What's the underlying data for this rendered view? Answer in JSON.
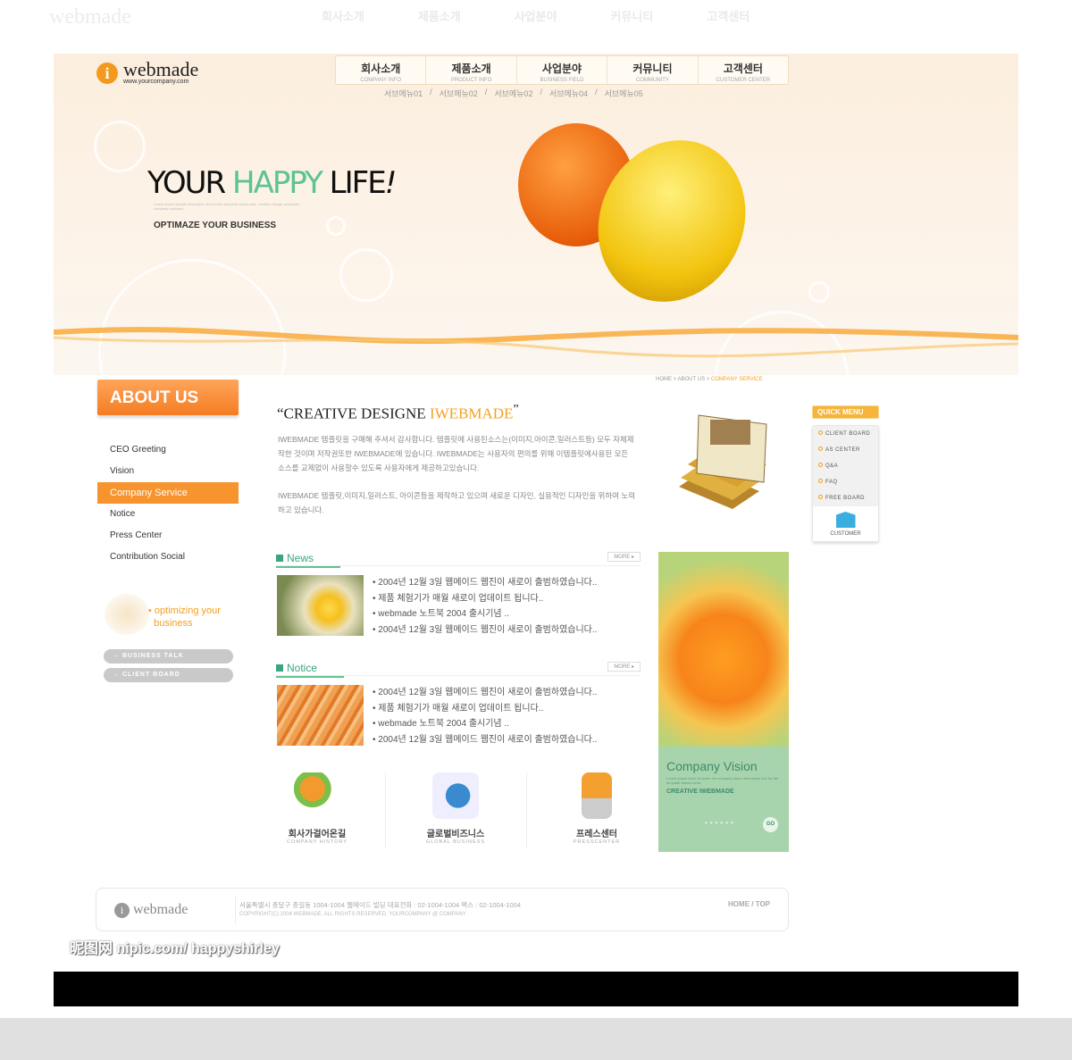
{
  "brand": {
    "name": "webmade",
    "url": "www.yourcompany.com",
    "icon": "i",
    "accent": "#f7942e",
    "green": "#5cc394"
  },
  "gnb": [
    {
      "ko": "회사소개",
      "en": "COMPANY INFO"
    },
    {
      "ko": "제품소개",
      "en": "PRODUCT INFO"
    },
    {
      "ko": "사업분야",
      "en": "BUSINESS FIELD"
    },
    {
      "ko": "커뮤니티",
      "en": "COMMUNITY"
    },
    {
      "ko": "고객센터",
      "en": "CUSTOMER CENTER"
    }
  ],
  "submenu": [
    "서브메뉴01",
    "/",
    "서브메뉴02",
    "/",
    "서브메뉴02",
    "/",
    "서브메뉴04",
    "/",
    "서브메뉴05"
  ],
  "hero": {
    "head1": "YOUR ",
    "head2": "HAPPY",
    "head3": " LIFE",
    "head4": "!",
    "tiny": "Lorem ipsum sample description text for the template visual area. Creative design webmade company business.",
    "sub": "OPTIMAZE YOUR BUSINESS"
  },
  "sidebar": {
    "title": "ABOUT US",
    "items": [
      "CEO Greeting",
      "Vision",
      "Company Service",
      "Notice",
      "Press Center",
      "Contribution Social"
    ],
    "promo1": "optimizing your",
    "promo2": "business",
    "buttons": [
      "→ BUSINESS TALK",
      "→ CLIENT BOARD"
    ],
    "bullet": "•"
  },
  "breadcrumb": {
    "a": "HOME > ABOUT US > ",
    "b": "COMPANY SERVICE"
  },
  "content": {
    "q1": "“",
    "title": "CREATIVE DESIGNE ",
    "title_hl": "IWEBMADE",
    "q2": "”",
    "p1": "IWEBMADE 템플릿을 구매해 주셔서 감사합니다. 템플릿에 사용된소스는(이미지,아이콘,일러스트등) 모두 자체제작한 것이며 저작권또한 IWEBMADE에 있습니다. IWEBMADE는 사용자의 편의를 위해 이템플릿에사용된 모든 소스를 교제없이 사용할수 있도록 사용자에게 제공하고있습니다.",
    "p2": "IWEBMADE 템플릿,이미지,일러스트, 아이콘등을 제작하고 있으며 새로운 디자인, 실용적인 디자인을 위하여 노력하고 있습니다."
  },
  "news": {
    "title": "News",
    "more": "MORE ▸",
    "items": [
      "• 2004년 12월 3일 웹메이드 웹진이 새로이 출범하였습니다..",
      "• 제품 체험기가 매월 새로이 업데이트 됩니다..",
      "• webmade 노트북 2004 출시기념 ..",
      "• 2004년 12월 3일 웹메이드 웹진이 새로이 출범하였습니다.."
    ]
  },
  "notice": {
    "title": "Notice",
    "more": "MORE ▸",
    "items": [
      "• 2004년 12월 3일 웹메이드 웹진이 새로이 출범하였습니다..",
      "• 제품 체험기가 매월 새로이 업데이트 됩니다..",
      "• webmade 노트북 2004 출시기념 ..",
      "• 2004년 12월 3일 웹메이드 웹진이 새로이 출범하였습니다.."
    ]
  },
  "quicklinks": [
    {
      "ko": "회사가걸어온길",
      "en": "COMPANY HISTORY"
    },
    {
      "ko": "글로벌비즈니스",
      "en": "GLOBAL BUSINESS"
    },
    {
      "ko": "프레스센터",
      "en": "PRESSCENTER"
    }
  ],
  "vision": {
    "title": "Company Vision",
    "desc": "Lorem ipsum dolor sit amet, the company vision description text for the template banner area.",
    "creative": "CREATIVE IWEBMADE",
    "dots": "••••••",
    "go": "GO"
  },
  "quickmenu": {
    "title": "QUICK MENU",
    "items": [
      "CLIENT BOARD",
      "AS CENTER",
      "Q&A",
      "FAQ",
      "FREE BOARD"
    ],
    "customer": "CUSTOMER"
  },
  "footer": {
    "logo": "webmade",
    "address": "서울특별시 종달구 종길동 1004-1004 웹메이드 빌딩   대표전화 : 02-1004-1004   팩스 : 02-1004-1004",
    "copyright": "COPYRIGHT(C) 2004 WEBMADE. ALL RIGHTS RESERVED. YOURCOMPANY @ COMPANY",
    "links": "HOME / TOP"
  },
  "watermark": "昵图网 nipic.com/ happyshirley"
}
